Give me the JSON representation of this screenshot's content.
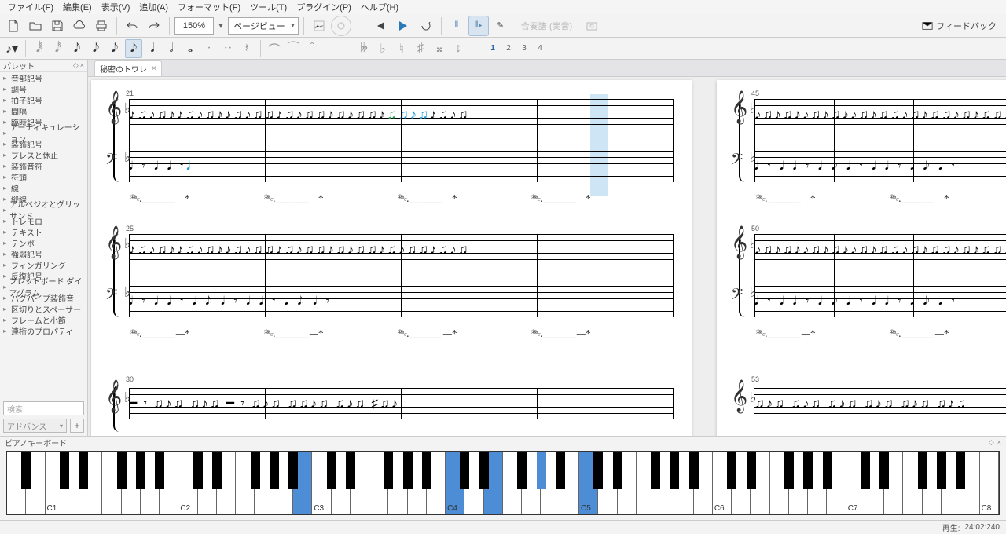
{
  "menu": {
    "file": "ファイル(F)",
    "edit": "編集(E)",
    "view": "表示(V)",
    "add": "追加(A)",
    "format": "フォーマット(F)",
    "tools": "ツール(T)",
    "plugins": "プラグイン(P)",
    "help": "ヘルプ(H)"
  },
  "toolbar": {
    "zoom": "150%",
    "page_view": "ページビュー",
    "synth_label": "合奏譜 (実音)",
    "feedback": "フィードバック"
  },
  "voices": [
    "1",
    "2",
    "3",
    "4"
  ],
  "palette": {
    "title": "パレット",
    "items": [
      "音部記号",
      "調号",
      "拍子記号",
      "間隔",
      "臨時記号",
      "アーティキュレーション",
      "装飾記号",
      "ブレスと休止",
      "装飾音符",
      "符頭",
      "線",
      "縦線",
      "アルペジオとグリッサンド",
      "トレモロ",
      "テキスト",
      "テンポ",
      "強弱記号",
      "フィンガリング",
      "反復記号",
      "フレットボード ダイアグラム",
      "バグパイプ装飾音",
      "区切りとスペーサー",
      "フレームと小節",
      "連桁のプロパティ"
    ],
    "search_placeholder": "検索",
    "advanced": "アドバンス"
  },
  "tab": {
    "title": "秘密のトワレ"
  },
  "measures": {
    "p1_s1": "21",
    "p1_s2": "25",
    "p1_s3": "30",
    "p2_s1": "45",
    "p2_s2": "50",
    "p2_s3": "53"
  },
  "pedal": "𝆮𝆯",
  "keyboard": {
    "title": "ピアノキーボード",
    "labels": [
      "C1",
      "C2",
      "C3",
      "C4",
      "C5",
      "C6",
      "C7",
      "C8"
    ],
    "highlightWhiteDeg": [
      15,
      23,
      25,
      30
    ],
    "highlightBlack": [
      18,
      27
    ]
  },
  "status": {
    "label": "再生:",
    "time": "24:02:240"
  }
}
